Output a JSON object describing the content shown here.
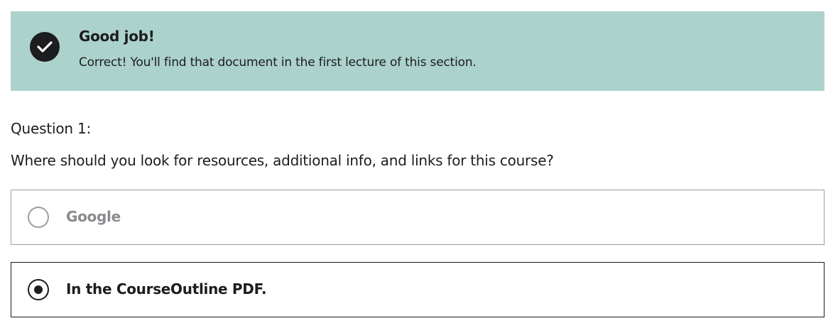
{
  "alert": {
    "icon": "checkmark-circle-icon",
    "title": "Good job!",
    "message": "Correct! You'll find that document in the first lecture of this section.",
    "background_color": "#acd2cc"
  },
  "question": {
    "number_label": "Question 1:",
    "text": "Where should you look for resources, additional info, and links for this course?"
  },
  "options": [
    {
      "label": "Google",
      "selected": false
    },
    {
      "label": "In the CourseOutline PDF.",
      "selected": true
    }
  ]
}
